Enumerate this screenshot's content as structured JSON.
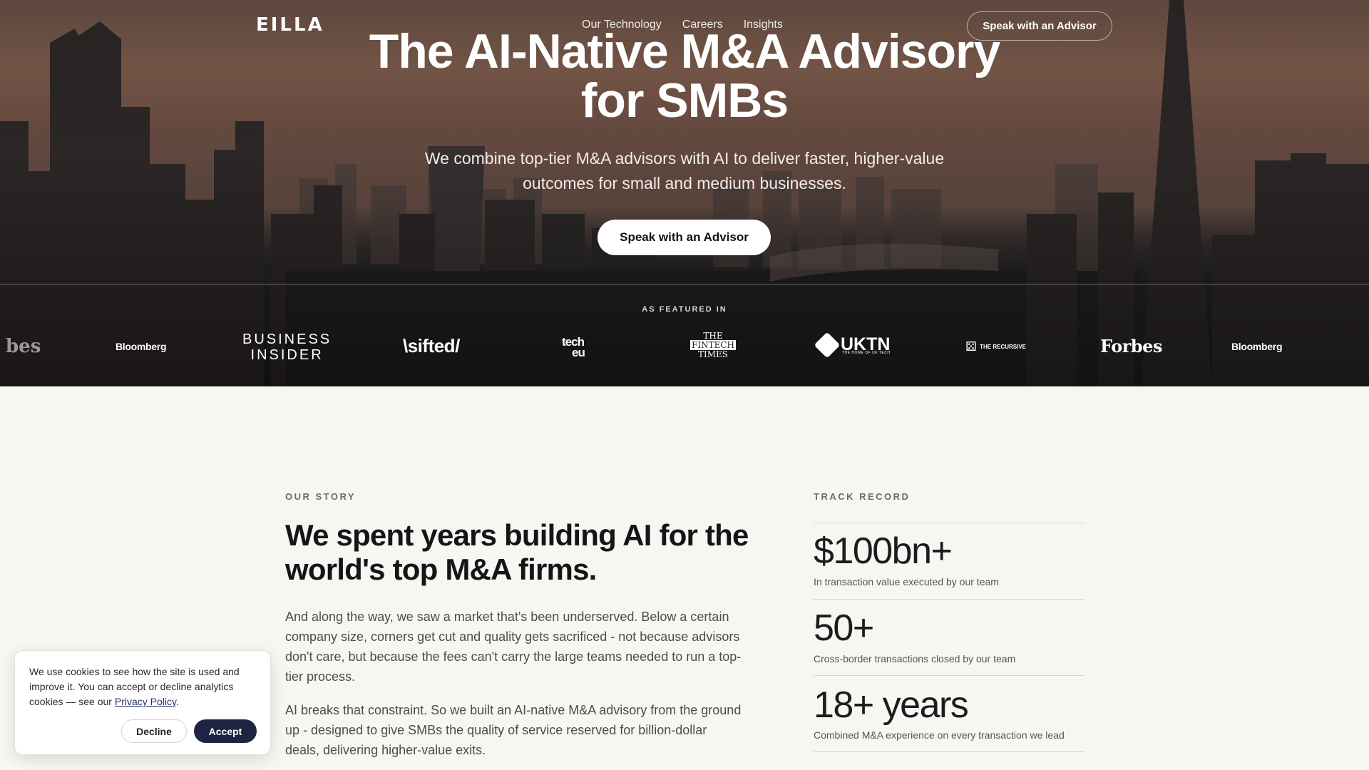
{
  "nav": {
    "logo": "EILLA",
    "links": [
      "Our Technology",
      "Careers",
      "Insights"
    ],
    "cta": "Speak with an Advisor"
  },
  "hero": {
    "title_line1": "The AI-Native M&A Advisory",
    "title_line2": "for SMBs",
    "subtitle_line1": "We combine top-tier M&A advisors with AI to deliver faster, higher-value",
    "subtitle_line2": "outcomes for small and medium businesses.",
    "cta": "Speak with an Advisor"
  },
  "press": {
    "label": "AS FEATURED IN",
    "logos": {
      "forbes_partial": "bes",
      "bloomberg": "Bloomberg",
      "business_line1": "BUSINESS",
      "business_line2": "INSIDER",
      "sifted": "\\sifted/",
      "techeu_line1": "tech",
      "techeu_line2": "eu",
      "fintech_line1": "THE",
      "fintech_line2": "FINTECH",
      "fintech_line3": "TIMES",
      "uktn": "UKTN",
      "uktn_tagline": "THE HOME OF UK TECH",
      "recursive": "THE RECURSIVE",
      "forbes": "Forbes",
      "bloomberg2": "Bloomberg"
    }
  },
  "story": {
    "label": "OUR STORY",
    "title": "We spent years building AI for the world's top M&A firms.",
    "paragraph1": "And along the way, we saw a market that's been underserved. Below a certain company size, corners get cut and quality gets sacrificed - not because advisors don't care, but because the fees can't carry the large teams needed to run a top-tier process.",
    "paragraph2": "AI breaks that constraint. So we built an AI-native M&A advisory from the ground up - designed to give SMBs the quality of service reserved for billion-dollar deals, delivering higher-value exits."
  },
  "track_record": {
    "label": "TRACK RECORD",
    "stats": [
      {
        "value": "$100bn+",
        "desc": "In transaction value executed by our team"
      },
      {
        "value": "50+",
        "desc": "Cross-border transactions closed by our team"
      },
      {
        "value": "18+ years",
        "desc": "Combined M&A experience on every transaction we lead"
      }
    ]
  },
  "cookie": {
    "text": "We use cookies to see how the site is used and improve it. You can accept or decline analytics cookies — see our ",
    "link": "Privacy Policy",
    "period": ".",
    "decline": "Decline",
    "accept": "Accept"
  }
}
